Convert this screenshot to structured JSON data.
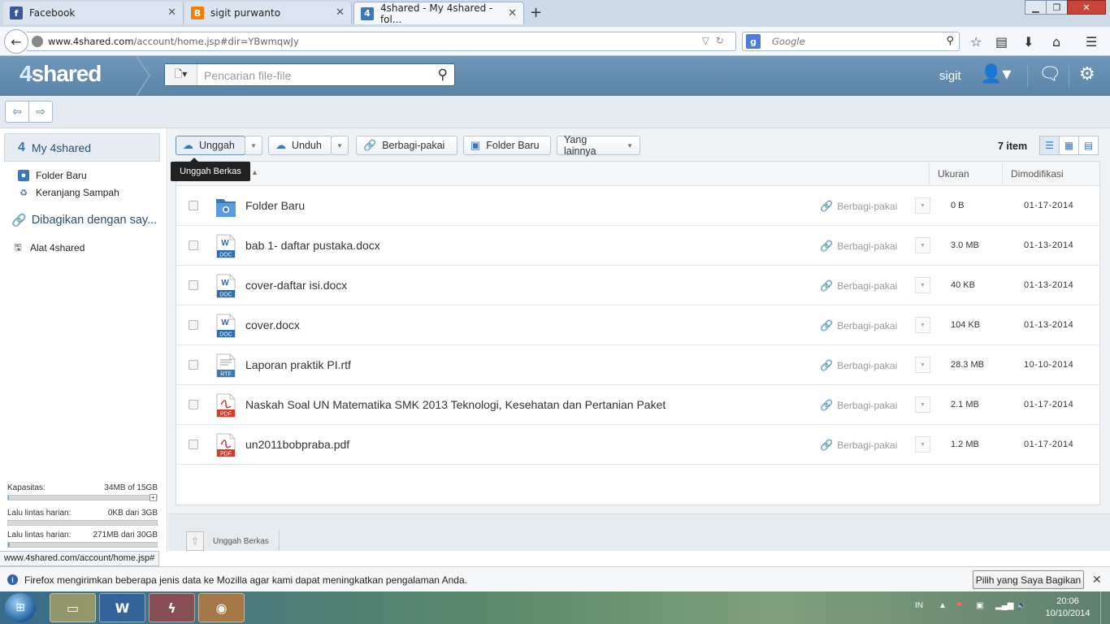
{
  "browser": {
    "tabs": [
      {
        "label": "Facebook",
        "favicon": "f",
        "color": "#3b5998"
      },
      {
        "label": "sigit purwanto",
        "favicon": "B",
        "color": "#f57d00"
      },
      {
        "label": "4shared - My 4shared - fol...",
        "favicon": "4",
        "color": "#3b78b4"
      }
    ],
    "new_tab": "+",
    "url_host": "www.4shared.com",
    "url_path": "/account/home.jsp#dir=YBwmqwJy",
    "search_placeholder": "Google"
  },
  "site": {
    "logo_four": "4",
    "logo_text": "shared",
    "search_placeholder": "Pencarian file-file",
    "username": "sigit"
  },
  "sidebar": {
    "my4shared": "My 4shared",
    "items": [
      {
        "label": "Folder Baru"
      },
      {
        "label": "Keranjang Sampah"
      }
    ],
    "shared_link": "Dibagikan dengan say...",
    "tools": "Alat 4shared",
    "stats": [
      {
        "label": "Kapasitas:",
        "value": "34MB of 15GB",
        "fraction": 0.002
      },
      {
        "label": "Lalu lintas harian:",
        "value": "0KB dari 3GB",
        "fraction": 0.0
      },
      {
        "label": "Lalu lintas harian:",
        "value": "271MB dari 30GB",
        "fraction": 0.009
      }
    ]
  },
  "toolbar": {
    "upload": "Unggah",
    "download": "Unduh",
    "share": "Berbagi-pakai",
    "new_folder": "Folder Baru",
    "more": "Yang lainnya",
    "tooltip": "Unggah Berkas",
    "item_count": "7 item"
  },
  "table": {
    "col_size": "Ukuran",
    "col_modified": "Dimodifikasi",
    "share_label": "Berbagi-pakai",
    "rows": [
      {
        "type": "folder",
        "name": "Folder Baru",
        "size": "0 B",
        "date": "01-17-2014"
      },
      {
        "type": "DOC",
        "name": "bab 1- daftar pustaka.docx",
        "size": "3.0 MB",
        "date": "01-13-2014"
      },
      {
        "type": "DOC",
        "name": "cover-daftar isi.docx",
        "size": "40 KB",
        "date": "01-13-2014"
      },
      {
        "type": "DOC",
        "name": "cover.docx",
        "size": "104 KB",
        "date": "01-13-2014"
      },
      {
        "type": "RTF",
        "name": "Laporan praktik PI.rtf",
        "size": "28.3 MB",
        "date": "10-10-2014"
      },
      {
        "type": "PDF",
        "name": "Naskah Soal UN Matematika SMK 2013 Teknologi, Kesehatan dan Pertanian Paket",
        "size": "2.1 MB",
        "date": "01-17-2014"
      },
      {
        "type": "PDF",
        "name": "un2011bobpraba.pdf",
        "size": "1.2 MB",
        "date": "01-17-2014"
      }
    ]
  },
  "footer": {
    "upload_files": "Unggah Berkas"
  },
  "status_url": "www.4shared.com/account/home.jsp#",
  "notification": {
    "message": "Firefox mengirimkan beberapa jenis data ke Mozilla agar kami dapat meningkatkan pengalaman Anda.",
    "button": "Pilih yang Saya Bagikan"
  },
  "taskbar": {
    "lang": "IN",
    "time": "20:06",
    "date": "10/10/2014"
  },
  "colors": {
    "header": "#5a84a8",
    "accent": "#3b78b4",
    "doc": "#2b6cb0",
    "pdf": "#d33a2c",
    "rtf": "#3b78b4"
  }
}
